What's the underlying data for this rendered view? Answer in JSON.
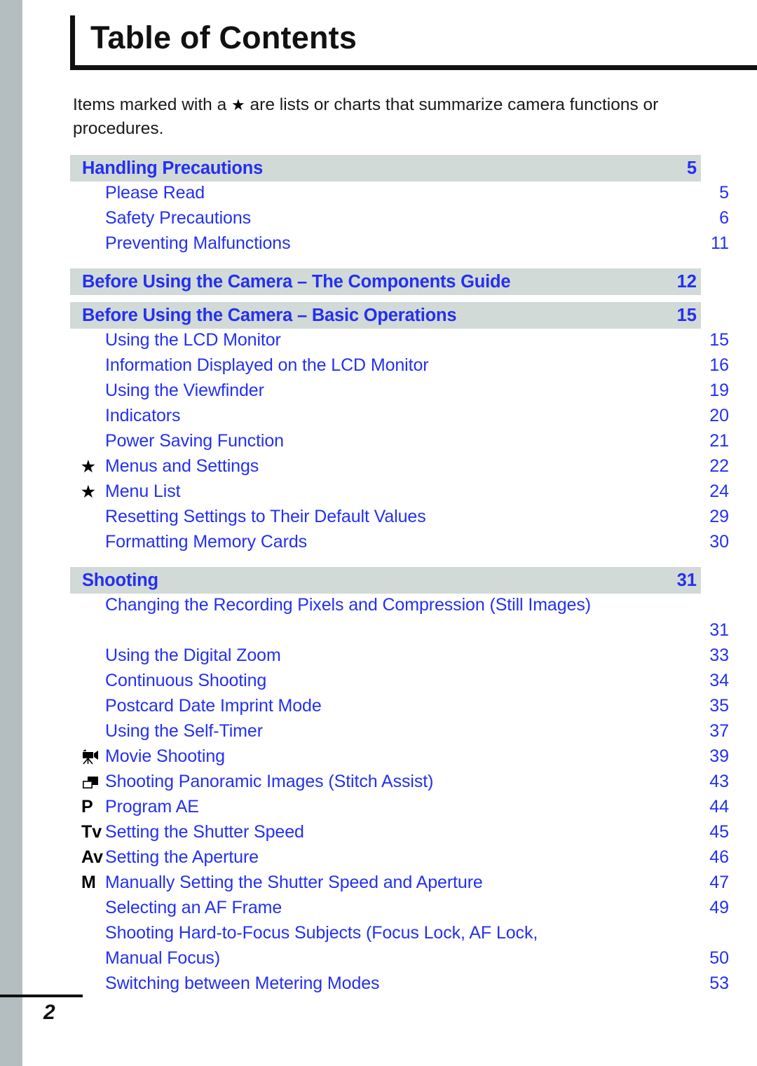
{
  "page": {
    "title": "Table of Contents",
    "folio": "2",
    "intro_prefix": "Items marked with a ",
    "intro_star": "★",
    "intro_suffix": " are lists or charts that summarize camera functions or procedures.",
    "accent_blue": "#2430ef",
    "band_gray": "#d2dad8",
    "edge_gray": "#b4bec0",
    "rule_black": "#111111"
  },
  "toc": {
    "sections": [
      {
        "title": "Handling Precautions",
        "page": "5",
        "entries": [
          {
            "mark": "",
            "mark_type": "none",
            "label": "Please Read",
            "page": "5"
          },
          {
            "mark": "",
            "mark_type": "none",
            "label": "Safety Precautions",
            "page": "6"
          },
          {
            "mark": "",
            "mark_type": "none",
            "label": "Preventing Malfunctions",
            "page": "11"
          }
        ]
      },
      {
        "title": "Before Using the Camera – The Components Guide",
        "page": "12",
        "entries": []
      },
      {
        "title": "Before Using the Camera – Basic Operations",
        "page": "15",
        "entries": [
          {
            "mark": "",
            "mark_type": "none",
            "label": "Using the LCD Monitor",
            "page": "15"
          },
          {
            "mark": "",
            "mark_type": "none",
            "label": "Information Displayed on the LCD Monitor",
            "page": "16"
          },
          {
            "mark": "",
            "mark_type": "none",
            "label": "Using the Viewfinder",
            "page": "19"
          },
          {
            "mark": "",
            "mark_type": "none",
            "label": "Indicators",
            "page": "20"
          },
          {
            "mark": "",
            "mark_type": "none",
            "label": "Power Saving Function",
            "page": "21"
          },
          {
            "mark": "★",
            "mark_type": "star",
            "label": "Menus and Settings",
            "page": "22"
          },
          {
            "mark": "★",
            "mark_type": "star",
            "label": "Menu List",
            "page": "24"
          },
          {
            "mark": "",
            "mark_type": "none",
            "label": "Resetting Settings to Their Default Values",
            "page": "29"
          },
          {
            "mark": "",
            "mark_type": "none",
            "label": "Formatting Memory Cards",
            "page": "30"
          }
        ]
      },
      {
        "title": "Shooting",
        "page": "31",
        "entries": [
          {
            "mark": "",
            "mark_type": "none",
            "label": "Changing the Recording Pixels and Compression (Still Images)",
            "page": "31",
            "wrap": true
          },
          {
            "mark": "",
            "mark_type": "none",
            "label": "Using the Digital Zoom",
            "page": "33"
          },
          {
            "mark": "",
            "mark_type": "none",
            "label": "Continuous Shooting",
            "page": "34"
          },
          {
            "mark": "",
            "mark_type": "none",
            "label": "Postcard Date Imprint Mode",
            "page": "35"
          },
          {
            "mark": "",
            "mark_type": "none",
            "label": "Using the Self-Timer",
            "page": "37"
          },
          {
            "mark": "movie-camera-icon",
            "mark_type": "icon",
            "label": "Movie Shooting",
            "page": "39"
          },
          {
            "mark": "stitch-assist-icon",
            "mark_type": "icon",
            "label": "Shooting Panoramic Images (Stitch Assist)",
            "page": "43"
          },
          {
            "mark": "P",
            "mark_type": "mode",
            "label": "Program AE",
            "page": "44"
          },
          {
            "mark": "Tv",
            "mark_type": "mode",
            "label": "Setting the Shutter Speed",
            "page": "45"
          },
          {
            "mark": "Av",
            "mark_type": "mode",
            "label": "Setting the Aperture",
            "page": "46"
          },
          {
            "mark": "M",
            "mark_type": "mode",
            "label": "Manually Setting the Shutter Speed and Aperture",
            "page": "47"
          },
          {
            "mark": "",
            "mark_type": "none",
            "label": "Selecting an AF Frame",
            "page": "49"
          },
          {
            "mark": "",
            "mark_type": "none",
            "label": "Shooting Hard-to-Focus Subjects (Focus Lock, AF Lock,",
            "page": "",
            "wrap2": true
          },
          {
            "mark": "",
            "mark_type": "none",
            "label": "Manual Focus)",
            "page": "50"
          },
          {
            "mark": "",
            "mark_type": "none",
            "label": "Switching between Metering Modes",
            "page": "53"
          }
        ]
      }
    ]
  }
}
